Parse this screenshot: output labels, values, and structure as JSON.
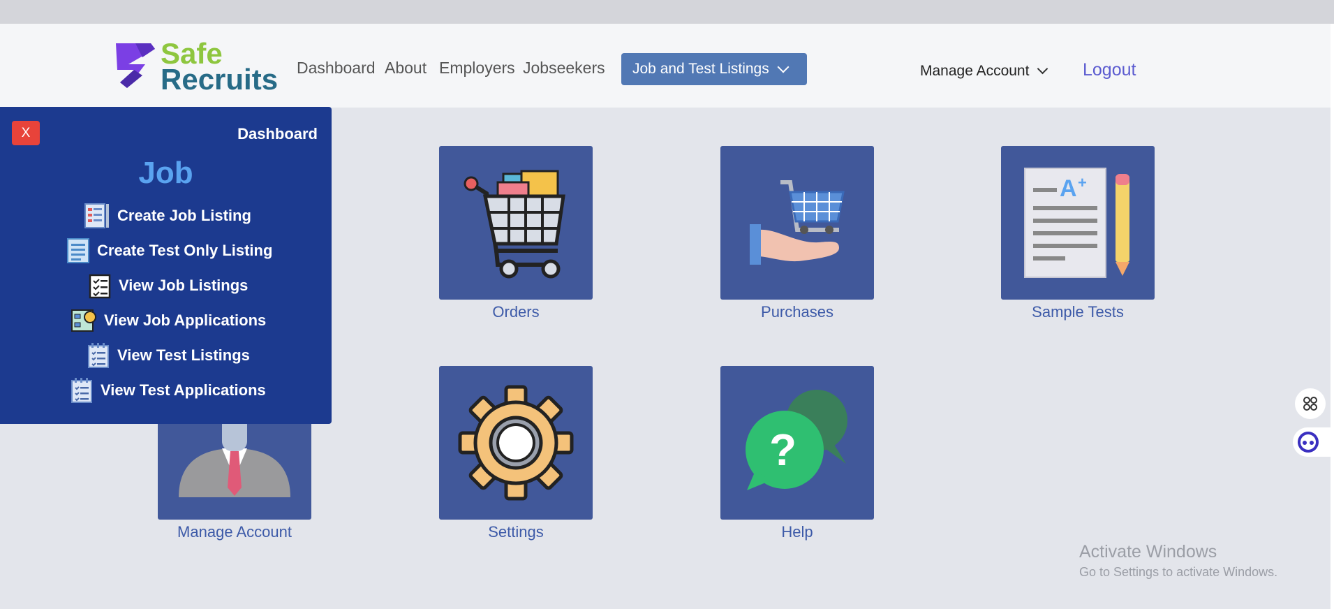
{
  "brand": {
    "line1": "Safe",
    "line2": "Recruits"
  },
  "nav": {
    "items": [
      "Dashboard",
      "About",
      "Employers",
      "Jobseekers"
    ],
    "job_test_button": "Job and Test Listings",
    "manage_account": "Manage Account",
    "logout": "Logout"
  },
  "tiles": [
    {
      "label": "Orders",
      "icon": "shopping-cart-icon"
    },
    {
      "label": "Purchases",
      "icon": "hand-cart-icon"
    },
    {
      "label": "Sample Tests",
      "icon": "test-paper-icon"
    },
    {
      "label": "Manage Account",
      "icon": "businessman-icon"
    },
    {
      "label": "Settings",
      "icon": "gear-icon"
    },
    {
      "label": "Help",
      "icon": "help-chat-icon"
    }
  ],
  "panel": {
    "close_label": "X",
    "dashboard_label": "Dashboard",
    "title": "Job",
    "items": [
      "Create Job Listing",
      "Create Test Only Listing",
      "View Job Listings",
      "View Job Applications",
      "View Test Listings",
      "View Test Applications"
    ]
  },
  "watermark": {
    "title": "Activate Windows",
    "subtitle": "Go to Settings to activate Windows."
  },
  "colors": {
    "panel_bg": "#1c3a8f",
    "tile_bg": "#41589a",
    "nav_button": "#5178b4",
    "logout": "#5b5bd0"
  }
}
